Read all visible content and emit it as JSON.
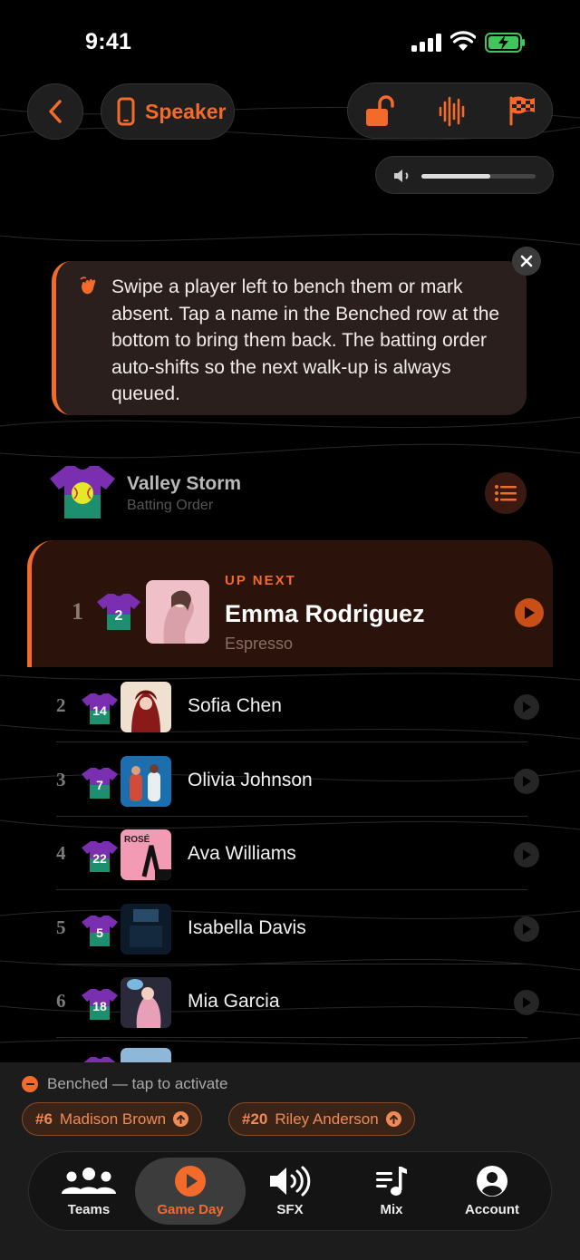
{
  "status": {
    "time": "9:41"
  },
  "top": {
    "speaker_label": "Speaker",
    "volume_level": 0.6
  },
  "tip": {
    "text": "Swipe a player left to bench them or mark absent. Tap a name in the Benched row at the bottom to bring them back. The batting order auto-shifts so the next walk-up is always queued."
  },
  "team": {
    "name": "Valley Storm",
    "subtitle": "Batting Order"
  },
  "up_next": {
    "tag": "UP NEXT",
    "order": "1",
    "jersey": "2",
    "name": "Emma Rodriguez",
    "song": "Espresso"
  },
  "lineup": [
    {
      "order": "2",
      "jersey": "14",
      "name": "Sofia Chen"
    },
    {
      "order": "3",
      "jersey": "7",
      "name": "Olivia Johnson"
    },
    {
      "order": "4",
      "jersey": "22",
      "name": "Ava Williams"
    },
    {
      "order": "5",
      "jersey": "5",
      "name": "Isabella Davis"
    },
    {
      "order": "6",
      "jersey": "18",
      "name": "Mia Garcia"
    }
  ],
  "benched": {
    "title": "Benched — tap to activate",
    "players": [
      {
        "jersey": "#6",
        "name": "Madison Brown"
      },
      {
        "jersey": "#20",
        "name": "Riley Anderson"
      }
    ]
  },
  "tabs": [
    {
      "label": "Teams",
      "icon": "people-icon"
    },
    {
      "label": "Game Day",
      "icon": "play-circle-icon"
    },
    {
      "label": "SFX",
      "icon": "speaker-icon"
    },
    {
      "label": "Mix",
      "icon": "music-list-icon"
    },
    {
      "label": "Account",
      "icon": "account-icon"
    }
  ],
  "colors": {
    "accent": "#f26b2a",
    "background": "#000000",
    "jersey_top": "#7a2fb0",
    "jersey_bottom": "#1e8f6e"
  }
}
